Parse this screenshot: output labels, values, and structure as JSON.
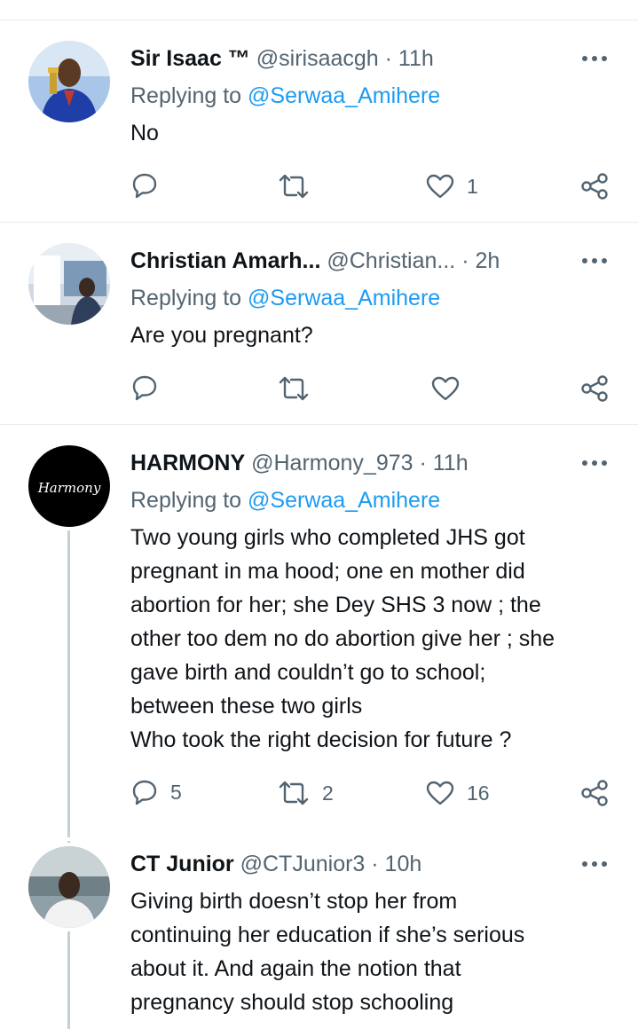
{
  "tweets": [
    {
      "name": "Sir Isaac ™",
      "handle": "@sirisaacgh",
      "time": "· 11h",
      "replying_prefix": "Replying to ",
      "replying_to": "@Serwaa_Amihere",
      "text": "No",
      "replies": "",
      "retweets": "",
      "likes": "1"
    },
    {
      "name": "Christian Amarh...",
      "handle": "@Christian...",
      "time": "· 2h",
      "replying_prefix": "Replying to ",
      "replying_to": "@Serwaa_Amihere",
      "text": "Are you pregnant?",
      "replies": "",
      "retweets": "",
      "likes": ""
    },
    {
      "name": "HARMONY",
      "handle": "@Harmony_973",
      "time": "· 11h",
      "avatar_text": "Harmony",
      "replying_prefix": "Replying to ",
      "replying_to": "@Serwaa_Amihere",
      "text": "Two young girls who completed JHS got\npregnant in ma hood; one en mother did\nabortion for her; she Dey SHS 3 now ; the\nother too dem no do abortion give her ; she\ngave birth and couldn’t go to school;\nbetween these two girls\nWho took the right decision for future ?",
      "replies": "5",
      "retweets": "2",
      "likes": "16"
    },
    {
      "name": "CT Junior",
      "handle": "@CTJunior3",
      "time": "· 10h",
      "text": "Giving birth doesn’t stop her from\ncontinuing her education if she’s serious\nabout it. And again the notion that\npregnancy should stop schooling"
    }
  ],
  "icons": {
    "reply": "reply-icon",
    "retweet": "retweet-icon",
    "like": "heart-icon",
    "share": "share-icon",
    "more": "more-icon"
  },
  "colors": {
    "link": "#1d9bf0",
    "secondary": "#536471",
    "text": "#0f1419",
    "divider": "#e6ecf0"
  }
}
